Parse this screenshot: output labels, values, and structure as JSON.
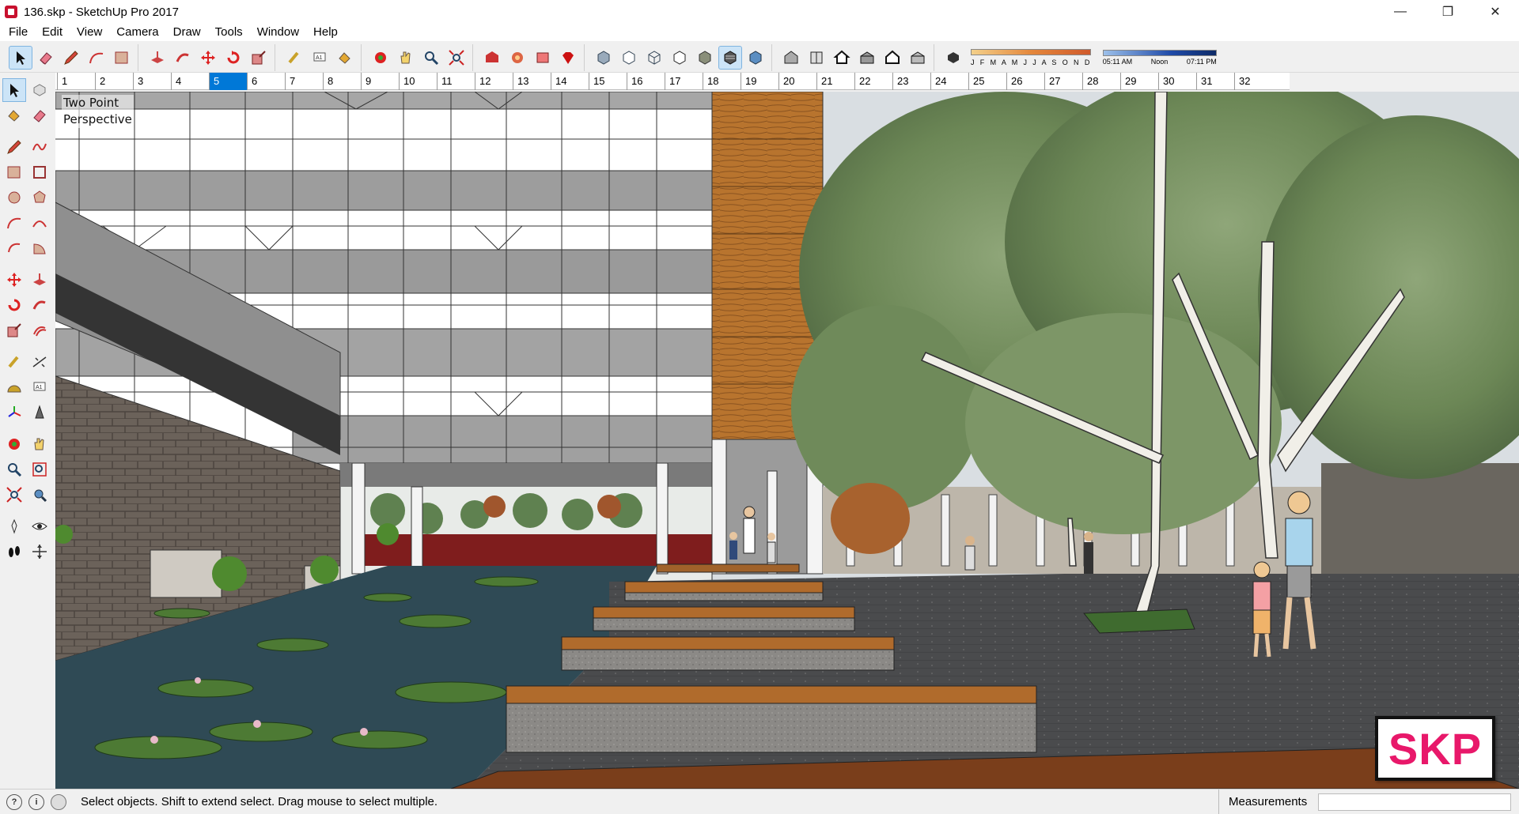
{
  "window": {
    "title": "136.skp - SketchUp Pro 2017",
    "controls": [
      "—",
      "❐",
      "✕"
    ]
  },
  "menu": [
    "File",
    "Edit",
    "View",
    "Camera",
    "Draw",
    "Tools",
    "Window",
    "Help"
  ],
  "toolbar": {
    "shadow_months": "J F M A M J J A S O N D",
    "shadow_time_start": "05:11 AM",
    "shadow_time_mid": "Noon",
    "shadow_time_end": "07:11 PM"
  },
  "ruler": {
    "ticks": [
      "1",
      "2",
      "3",
      "4",
      "5",
      "6",
      "7",
      "8",
      "9",
      "10",
      "11",
      "12",
      "13",
      "14",
      "15",
      "16",
      "17",
      "18",
      "19",
      "20",
      "21",
      "22",
      "23",
      "24",
      "25",
      "26",
      "27",
      "28",
      "29",
      "30",
      "31",
      "32"
    ],
    "active_index": 4
  },
  "viewport": {
    "view_label_line1": "Two Point",
    "view_label_line2": "Perspective",
    "logo": "SKP"
  },
  "status": {
    "message": "Select objects. Shift to extend select. Drag mouse to select multiple.",
    "measurements_label": "Measurements",
    "measurements_value": ""
  },
  "colors": {
    "accent": "#0078d7",
    "logo_pink": "#e8186a",
    "wood": "#b8742e",
    "water": "#2f4a55",
    "foliage": "#6f8a5a"
  }
}
